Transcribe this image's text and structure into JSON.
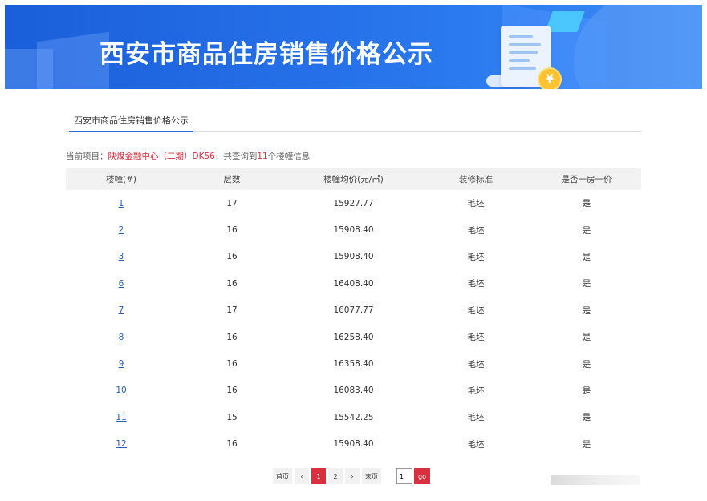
{
  "banner": {
    "title": "西安市商品住房销售价格公示",
    "coin_symbol": "¥"
  },
  "tab": {
    "label": "西安市商品住房销售价格公示"
  },
  "info": {
    "prefix": "当前项目：",
    "project": "陕煤金融中心（二期）DK56",
    "middle": "，共查询到",
    "count": "11",
    "suffix": "个楼幢信息"
  },
  "table": {
    "headers": [
      "楼幢(#)",
      "层数",
      "楼幢均价(元/㎡)",
      "装修标准",
      "是否一房一价"
    ],
    "rows": [
      {
        "building": "1",
        "floors": "17",
        "price": "15927.77",
        "decoration": "毛坯",
        "one_price": "是"
      },
      {
        "building": "2",
        "floors": "16",
        "price": "15908.40",
        "decoration": "毛坯",
        "one_price": "是"
      },
      {
        "building": "3",
        "floors": "16",
        "price": "15908.40",
        "decoration": "毛坯",
        "one_price": "是"
      },
      {
        "building": "6",
        "floors": "16",
        "price": "16408.40",
        "decoration": "毛坯",
        "one_price": "是"
      },
      {
        "building": "7",
        "floors": "17",
        "price": "16077.77",
        "decoration": "毛坯",
        "one_price": "是"
      },
      {
        "building": "8",
        "floors": "16",
        "price": "16258.40",
        "decoration": "毛坯",
        "one_price": "是"
      },
      {
        "building": "9",
        "floors": "16",
        "price": "16358.40",
        "decoration": "毛坯",
        "one_price": "是"
      },
      {
        "building": "10",
        "floors": "16",
        "price": "16083.40",
        "decoration": "毛坯",
        "one_price": "是"
      },
      {
        "building": "11",
        "floors": "15",
        "price": "15542.25",
        "decoration": "毛坯",
        "one_price": "是"
      },
      {
        "building": "12",
        "floors": "16",
        "price": "15908.40",
        "decoration": "毛坯",
        "one_price": "是"
      }
    ]
  },
  "pager": {
    "first": "首页",
    "prev": "‹",
    "pages": [
      "1",
      "2"
    ],
    "current": "1",
    "next": "›",
    "last": "末页",
    "input_value": "1",
    "go": "go"
  },
  "colors": {
    "accent_red": "#d9303e",
    "link_blue": "#2a5fb0",
    "banner_blue": "#2570e8"
  }
}
